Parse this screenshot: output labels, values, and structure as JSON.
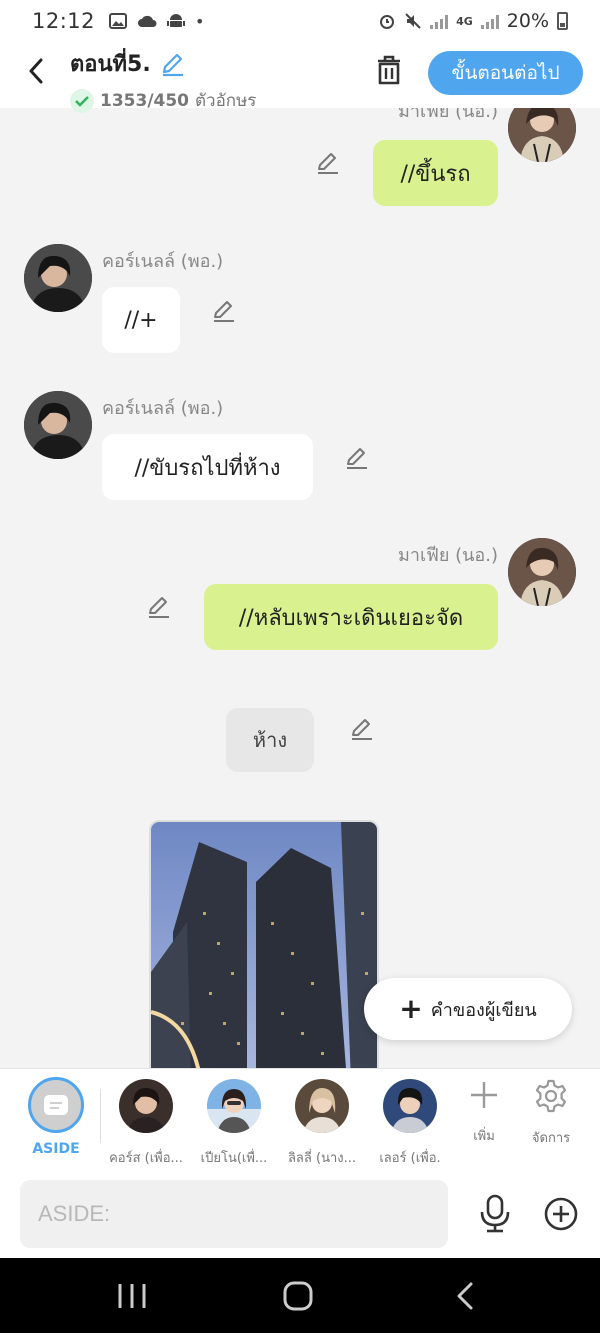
{
  "status_bar": {
    "time": "12:12",
    "network": "4G",
    "battery": "20%"
  },
  "header": {
    "title": "ตอนที่5.",
    "char_count": "1353/450",
    "char_unit": "ตัวอักษร",
    "next_button": "ขั้นตอนต่อไป"
  },
  "messages": [
    {
      "speaker": "มาเฟีย (นอ.)",
      "text": "//ขึ้นรถ",
      "side": "right"
    },
    {
      "speaker": "คอร์เนลล์ (พอ.)",
      "text": "//+",
      "side": "left"
    },
    {
      "speaker": "คอร์เนลล์ (พอ.)",
      "text": "//ขับรถไปที่ห้าง",
      "side": "left"
    },
    {
      "speaker": "มาเฟีย (นอ.)",
      "text": "//หลับเพราะเดินเยอะจัด",
      "side": "right"
    },
    {
      "speaker": "",
      "text": "ห้าง",
      "side": "narration"
    }
  ],
  "writer_button": "คำของผู้เขียน",
  "characters": {
    "aside_label": "ASIDE",
    "items": [
      {
        "label": "คอร์ส (เพื่อ..."
      },
      {
        "label": "เปียโน(เพื่..."
      },
      {
        "label": "ลิลลี่ (นาง..."
      },
      {
        "label": "เลอร์ (เพื่อ."
      }
    ],
    "add_label": "เพิ่ม",
    "manage_label": "จัดการ"
  },
  "input": {
    "placeholder": "ASIDE:"
  },
  "colors": {
    "accent": "#4fa6ee",
    "bubble_right": "#d9f28f",
    "bubble_left": "#ffffff",
    "background": "#f3f3f3"
  }
}
